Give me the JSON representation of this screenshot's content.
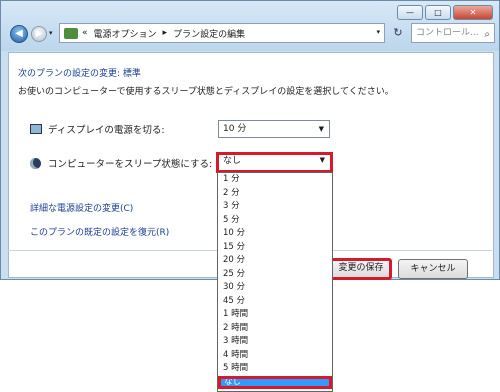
{
  "window": {
    "caption_buttons": {
      "minimize": "—",
      "maximize": "□",
      "close": "✕"
    },
    "address": {
      "overflow": "«",
      "crumbs": [
        "電源オプション",
        "▸",
        "プラン設定の編集"
      ],
      "dropdown_arrow": "▾"
    },
    "search_placeholder": "コントロール...",
    "nav": {
      "back": "◀",
      "forward": "▶",
      "history": "▾",
      "refresh": "↻",
      "search_icon": "⌕"
    }
  },
  "page": {
    "title": "次のプランの設定の変更: 標準",
    "subtitle": "お使いのコンピューターで使用するスリープ状態とディスプレイの設定を選択してください。",
    "display_off": {
      "label": "ディスプレイの電源を切る:",
      "value": "10 分"
    },
    "sleep": {
      "label": "コンピューターをスリープ状態にする:",
      "value": "なし"
    },
    "links": {
      "advanced": "詳細な電源設定の変更(C)",
      "restore": "このプランの既定の設定を復元(R)"
    },
    "buttons": {
      "save": "変更の保存",
      "cancel": "キャンセル"
    }
  },
  "dropdown": {
    "options": [
      "1 分",
      "2 分",
      "3 分",
      "5 分",
      "10 分",
      "15 分",
      "20 分",
      "25 分",
      "30 分",
      "45 分",
      "1 時間",
      "2 時間",
      "3 時間",
      "4 時間",
      "5 時間",
      "なし"
    ],
    "selected_index": 15
  },
  "colors": {
    "highlight": "#d6192b",
    "selection": "#3399ff",
    "link": "#1a3f91"
  }
}
